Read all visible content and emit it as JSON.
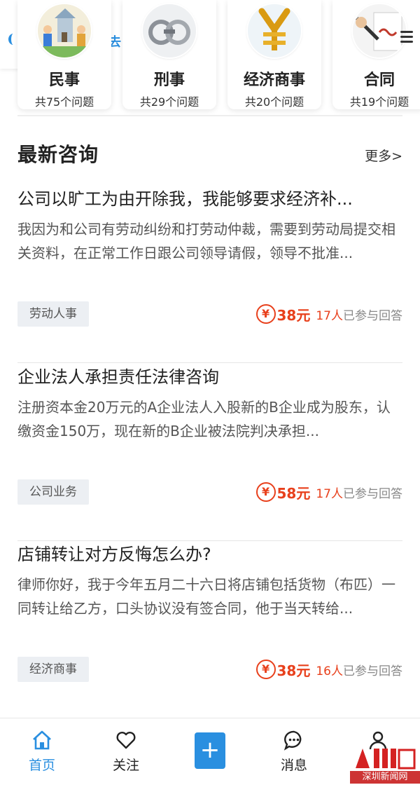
{
  "categories": [
    {
      "name": "民事",
      "count": "共75个问题"
    },
    {
      "name": "刑事",
      "count": "共29个问题"
    },
    {
      "name": "经济商事",
      "count": "共20个问题"
    },
    {
      "name": "合同",
      "count": "共19个问题"
    }
  ],
  "partial_card_text": "去",
  "section": {
    "title": "最新咨询",
    "more": "更多>"
  },
  "questions": [
    {
      "title": "公司以旷工为由开除我，我能够要求经济补...",
      "body": "我因为和公司有劳动纠纷和打劳动仲裁，需要到劳动局提交相关资料，在正常工作日跟公司领导请假，领导不批准...",
      "tag": "劳动人事",
      "yen": "¥",
      "price": "38元",
      "persons": "17人",
      "answered": "已参与回答"
    },
    {
      "title": "企业法人承担责任法律咨询",
      "body": "注册资本金20万元的A企业法人入股新的B企业成为股东，认缴资金150万，现在新的B企业被法院判决承担...",
      "tag": "公司业务",
      "yen": "¥",
      "price": "58元",
      "persons": "17人",
      "answered": "已参与回答"
    },
    {
      "title": "店铺转让对方反悔怎么办?",
      "body": "律师你好，我于今年五月二十六日将店铺包括货物（布匹）一同转让给乙方，口头协议没有签合同，他于当天转给...",
      "tag": "经济商事",
      "yen": "¥",
      "price": "38元",
      "persons": "16人",
      "answered": "已参与回答"
    }
  ],
  "nav": {
    "home": "首页",
    "follow": "关注",
    "plus": "+",
    "messages": "消息"
  },
  "watermark": "深圳新闻网",
  "colors": {
    "accent": "#2a8fe0",
    "price": "#e8401c",
    "tag_bg": "#eceff3"
  }
}
